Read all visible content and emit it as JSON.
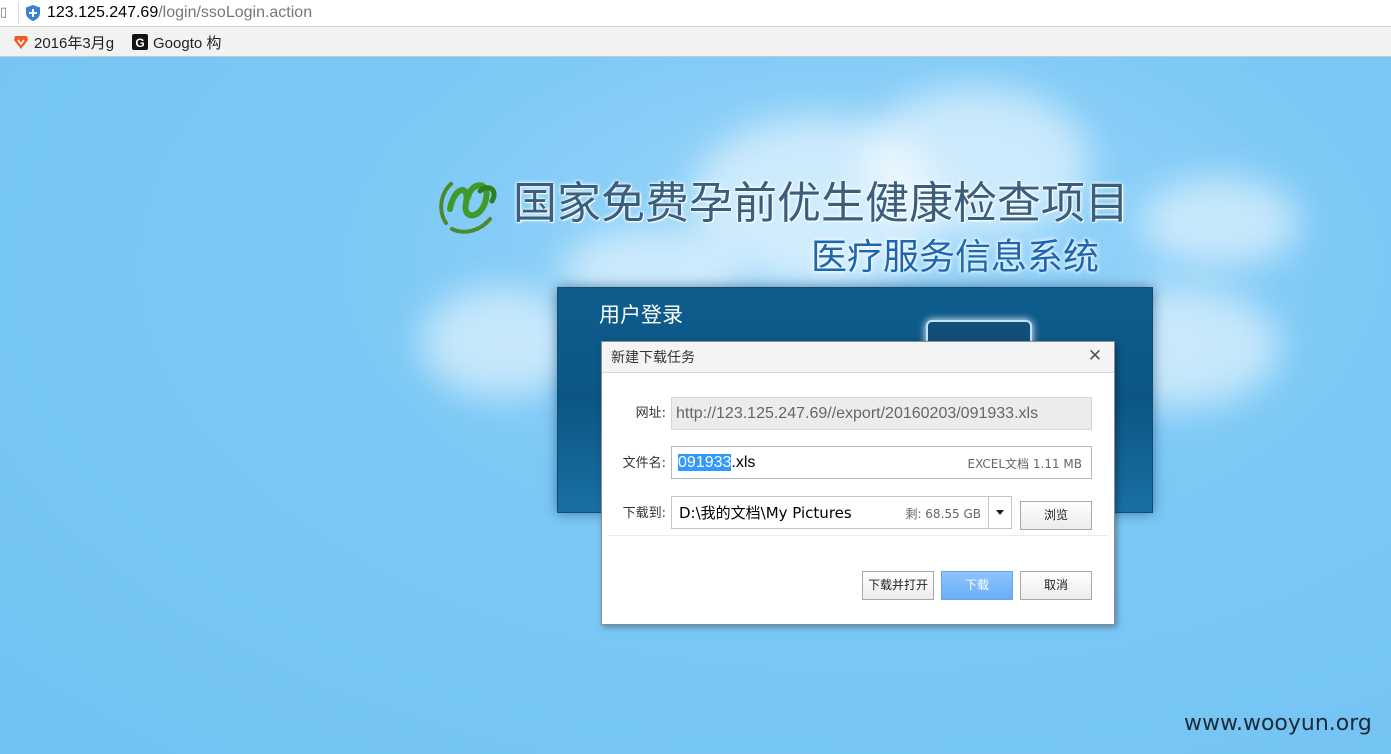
{
  "browser": {
    "address_host": "123.125.247.69",
    "address_path": "/login/ssoLogin.action",
    "bookmarks": [
      {
        "label": "2016年3月g",
        "icon": "brave-lion-icon"
      },
      {
        "label": "Googto 构",
        "icon": "g-letter-icon"
      }
    ]
  },
  "page": {
    "title_main": "国家免费孕前优生健康检查项目",
    "title_sub": "医疗服务信息系统",
    "login_title": "用户登录",
    "watermark": "www.wooyun.org"
  },
  "dialog": {
    "title": "新建下载任务",
    "close": "✕",
    "url_label": "网址:",
    "url_value": "http://123.125.247.69//export/20160203/091933.xls",
    "name_label": "文件名:",
    "name_selected": "091933",
    "name_ext": ".xls",
    "name_meta": "EXCEL文档  1.11 MB",
    "path_label": "下载到:",
    "path_value": "D:\\我的文档\\My Pictures",
    "path_free": "剩: 68.55 GB",
    "browse_label": "浏览",
    "open_label": "下载并打开",
    "download_label": "下载",
    "cancel_label": "取消"
  },
  "colors": {
    "sky": "#76c6f4",
    "login_panel": "#0e5d8d",
    "title_blue": "#1e67b0",
    "selection": "#3399ff"
  }
}
